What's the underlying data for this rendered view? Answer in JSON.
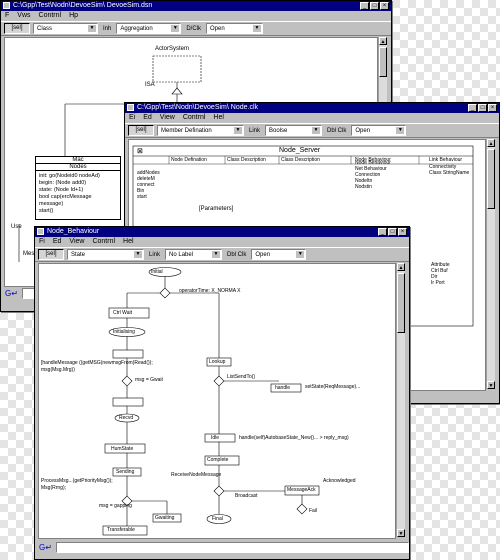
{
  "window_main": {
    "title": "C:\\Gpp\\Test\\Nodn\\DevoeSim\\ DevoeSim.dsn",
    "menu": [
      "F",
      "Vws",
      "Contrnl",
      "Hp"
    ],
    "toolbar": {
      "button1": "[sel]",
      "combo1": "Class",
      "label1": "Inh",
      "combo2": "Aggregation",
      "label2": "D/Clk",
      "combo3": "Open"
    },
    "canvas_labels": {
      "top": "ActorSystem",
      "isa": "ISA",
      "uses": "Use",
      "bottom_left": "Mes"
    },
    "classbox": {
      "title": "Mac",
      "subtitle": "Nodes",
      "lines": [
        "init: go(Nodeid0 nodeAd)",
        "begin: (Node add0)",
        "state: (Node Id+1)",
        "bool cap(ercMessage message)",
        "start()"
      ]
    },
    "status_icon": "G↵"
  },
  "window_node": {
    "title": "C:\\Gpp\\Test\\Nodn\\DevoeSim\\ Node.clk",
    "menu": [
      "Ei",
      "Ed",
      "View",
      "Contrnl",
      "Hel"
    ],
    "toolbar": {
      "button1": "[sel]",
      "combo1": "Member Defination",
      "label1": "Link",
      "combo2": "Boolse",
      "label2": "Dbl Clk",
      "combo3": "Open"
    },
    "header": "Node_Server",
    "columns": [
      "Node Defination",
      "Class Description",
      "Class Description",
      "Node Behaviour",
      "Link Behaviour"
    ],
    "col1_items": [
      "addNodes",
      "deleteM",
      "connect",
      "Bin",
      "start"
    ],
    "col4_items": [
      "Node Behaviour",
      "Net Behaviour",
      "Connection",
      "Nodeltn",
      "Nodstin"
    ],
    "col5_items": [
      "Connectivity",
      "Class StringName"
    ],
    "mid_text": "[Parameters]",
    "right_items": [
      "Attribute",
      "Ctrl Buf",
      "Dir",
      "Ir Port"
    ]
  },
  "window_behaviour": {
    "title": "Node_Behaviour",
    "menu": [
      "Fi",
      "Ed",
      "View",
      "Contrnl",
      "Hel"
    ],
    "toolbar": {
      "button1": "[sel]",
      "combo1": "State",
      "label1": "Link",
      "combo2": "No Label",
      "label2": "Dbl Clk",
      "combo3": "Open"
    },
    "diagram": {
      "start": "Initial",
      "left_top": "operatorTime: X_NORMA  X",
      "left_state1": "Initialising",
      "left_box1": "Ctrl Wait",
      "left_msg1": "[handleMessage ((getMSG(newmsgFrom)Read());",
      "left_msg2": "msg(Msg.Mrg))",
      "left_dec1": "msg = Gwait",
      "left_rec": "Recvd",
      "left_mid": "HumState",
      "left_send": "Sending",
      "left_msg3": "ProcessMsg...(getPriorityMsg());",
      "left_msg4": "Msg(Rrng);",
      "left_dec2": "msg = gapping",
      "left_state2": "Gwaiting",
      "left_bottom": "Transferable",
      "mid_top": "Lookup",
      "mid_dec": "ListSendTo()",
      "mid_box": "handle",
      "mid_note": "setState(ReqMessage)...",
      "mid_state": "Idle",
      "mid_msg": "handle(self)AutobaseState_New()... > reply_msg)",
      "mid_comp": "Complete",
      "mid_msg2": "ReceiveNodeMessage",
      "mid_end": "Final",
      "right_box": "MessageAck",
      "right_note": "Acknowledged",
      "right_small": "Broadcast",
      "right_dec": "Fail"
    },
    "status_icon": "G↵"
  },
  "colors": {
    "titlebar": "#000080",
    "chrome": "#c0c0c0",
    "accent_status": "#0000c0"
  }
}
